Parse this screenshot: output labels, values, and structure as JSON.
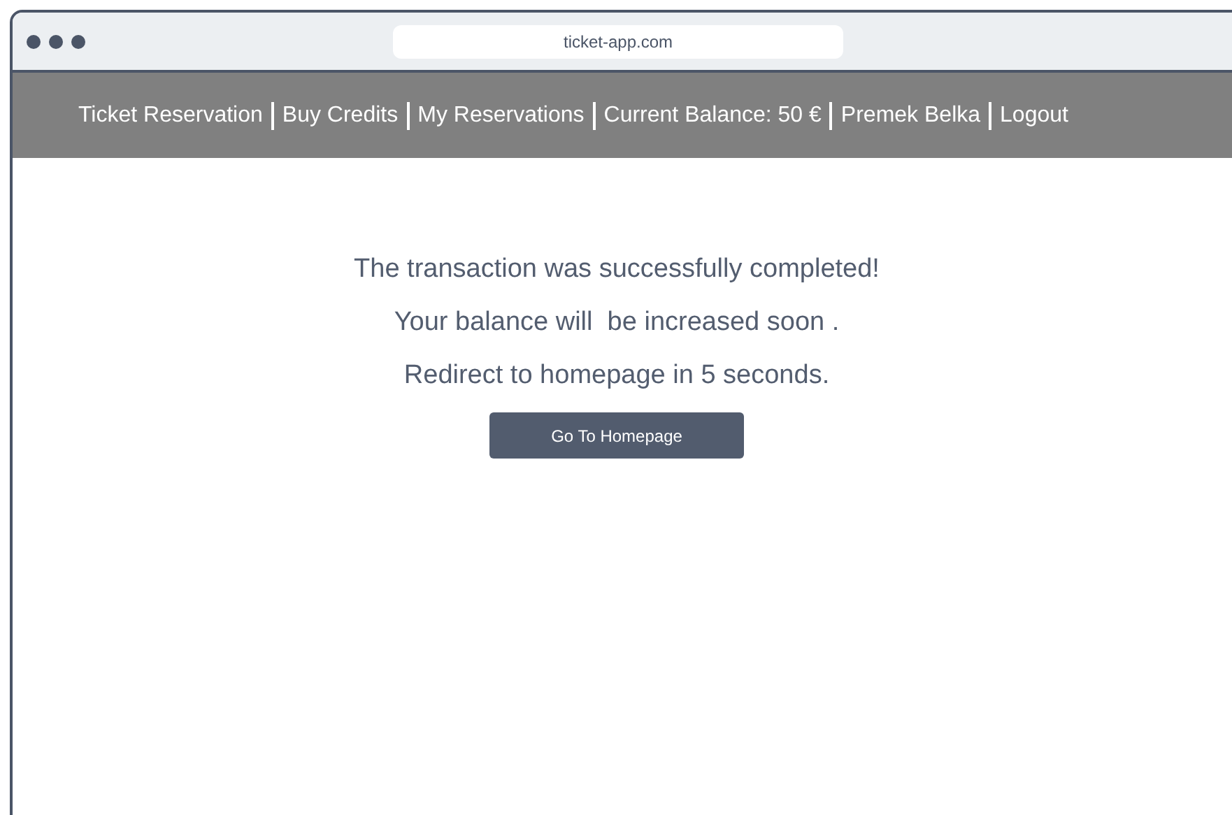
{
  "browser": {
    "address": "ticket-app.com"
  },
  "nav": [
    {
      "label": "Ticket Reservation"
    },
    {
      "label": "Buy Credits"
    },
    {
      "label": "My Reservations"
    },
    {
      "label": "Current Balance: 50 €"
    },
    {
      "label": "Premek Belka"
    },
    {
      "label": "Logout"
    }
  ],
  "messages": [
    "The transaction was successfully completed!",
    "Your balance will  be increased soon .",
    "Redirect to homepage in 5 seconds."
  ],
  "button": {
    "label": "Go To Homepage"
  }
}
